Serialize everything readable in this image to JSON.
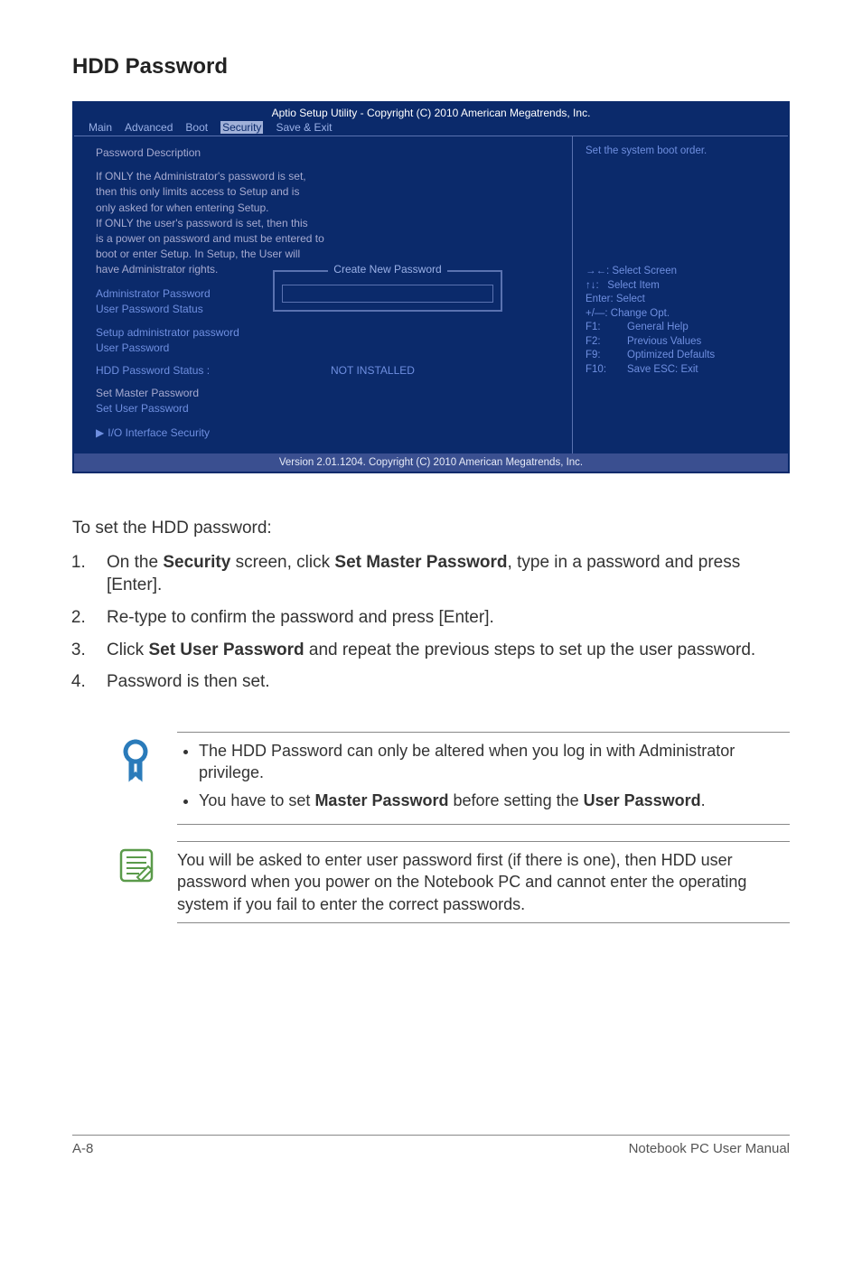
{
  "section_title": "HDD Password",
  "bios": {
    "header": "Aptio Setup Utility - Copyright (C) 2010 American Megatrends, Inc.",
    "tabs": [
      "Main",
      "Advanced",
      "Boot",
      "Security",
      "Save & Exit"
    ],
    "active_tab": "Security",
    "left": {
      "pwd_desc_title": "Password Description",
      "pwd_desc_lines": [
        "If ONLY the Administrator's password is set,",
        "then this only limits access to Setup and is",
        "only asked for when entering Setup.",
        "If ONLY the user's password is set, then this",
        "is a power on password and must be entered to",
        "boot or enter Setup. In Setup, the User will",
        "have Administrator rights."
      ],
      "admin_pwd": "Administrator Password",
      "user_pwd_status": "User Password Status",
      "setup_admin_pwd": "Setup administrator password",
      "user_pwd": "User Password",
      "hdd_status_label": "HDD Password Status :",
      "hdd_status_value": "NOT INSTALLED",
      "set_master": "Set Master Password",
      "set_user": "Set User Password",
      "io_sec": "I/O Interface Security",
      "popup_title": "Create New Password"
    },
    "right": {
      "top_hint": "Set the system boot order.",
      "help": {
        "l1": "Select Screen",
        "l2": "Select Item",
        "l3": "Enter: Select",
        "l4": "+/—:  Change Opt.",
        "l5k": "F1:",
        "l5v": "General Help",
        "l6k": "F2:",
        "l6v": "Previous Values",
        "l7k": "F9:",
        "l7v": "Optimized Defaults",
        "l8k": "F10:",
        "l8v": "Save   ESC: Exit"
      }
    },
    "footer": "Version 2.01.1204. Copyright (C) 2010 American Megatrends, Inc."
  },
  "intro": "To set the HDD password:",
  "steps": {
    "s1a": "On the ",
    "s1b": "Security",
    "s1c": " screen, click ",
    "s1d": "Set Master Password",
    "s1e": ", type in a password and press [Enter].",
    "s2": "Re-type to confirm the password and press [Enter].",
    "s3a": "Click ",
    "s3b": "Set User Password",
    "s3c": " and repeat the previous steps to set up the user password.",
    "s4": "Password is then set."
  },
  "callout1": {
    "b1": "The HDD Password can only be altered when you log in with Administrator privilege.",
    "b2a": "You have to set ",
    "b2b": "Master Password",
    "b2c": " before setting the ",
    "b2d": "User Password",
    "b2e": "."
  },
  "callout2": {
    "text": "You will be asked to enter user password first (if there is one), then HDD user password when you power on the Notebook PC and cannot enter the operating system if you fail to enter the correct passwords."
  },
  "footer": {
    "page": "A-8",
    "manual": "Notebook PC User Manual"
  }
}
